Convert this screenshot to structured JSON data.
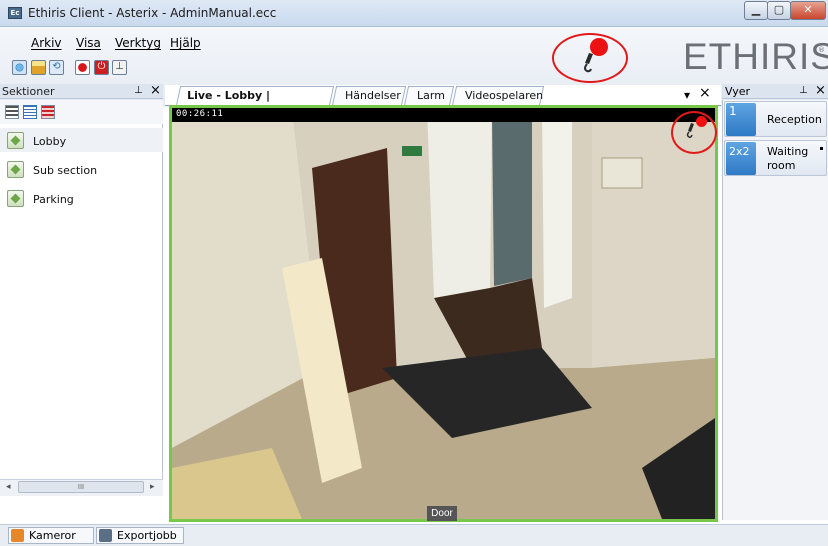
{
  "window": {
    "title": "Ethiris Client - Asterix - AdminManual.ecc",
    "app_icon_text": "Ec"
  },
  "menu": {
    "items": [
      "Arkiv",
      "Visa",
      "Verktyg",
      "Hjälp"
    ]
  },
  "brand": {
    "logo": "ETHIRIS",
    "logo_mark": "®"
  },
  "left_panel": {
    "title": "Sektioner",
    "pin": "⊥",
    "close": "×",
    "sections": [
      "Lobby",
      "Sub section",
      "Parking"
    ],
    "scroll_thumb": "III"
  },
  "tabs": {
    "items": [
      "Live - Lobby | Reception",
      "Händelser",
      "Larm",
      "Videospelaren"
    ],
    "active": 0,
    "dropdown": "▾",
    "close": "×"
  },
  "video": {
    "timestamp": "00:26:11",
    "camera_label": "Door"
  },
  "right_panel": {
    "title": "Vyer",
    "pin": "⊥",
    "close": "×",
    "views": [
      {
        "icon_text": "1",
        "label": "Reception"
      },
      {
        "icon_text": "2x2",
        "label": "Waiting room"
      }
    ]
  },
  "bottom_tabs": [
    "Kameror",
    "Exportjobb"
  ],
  "colors": {
    "accent_green": "#76c74a",
    "highlight_red": "#e01a1a"
  }
}
